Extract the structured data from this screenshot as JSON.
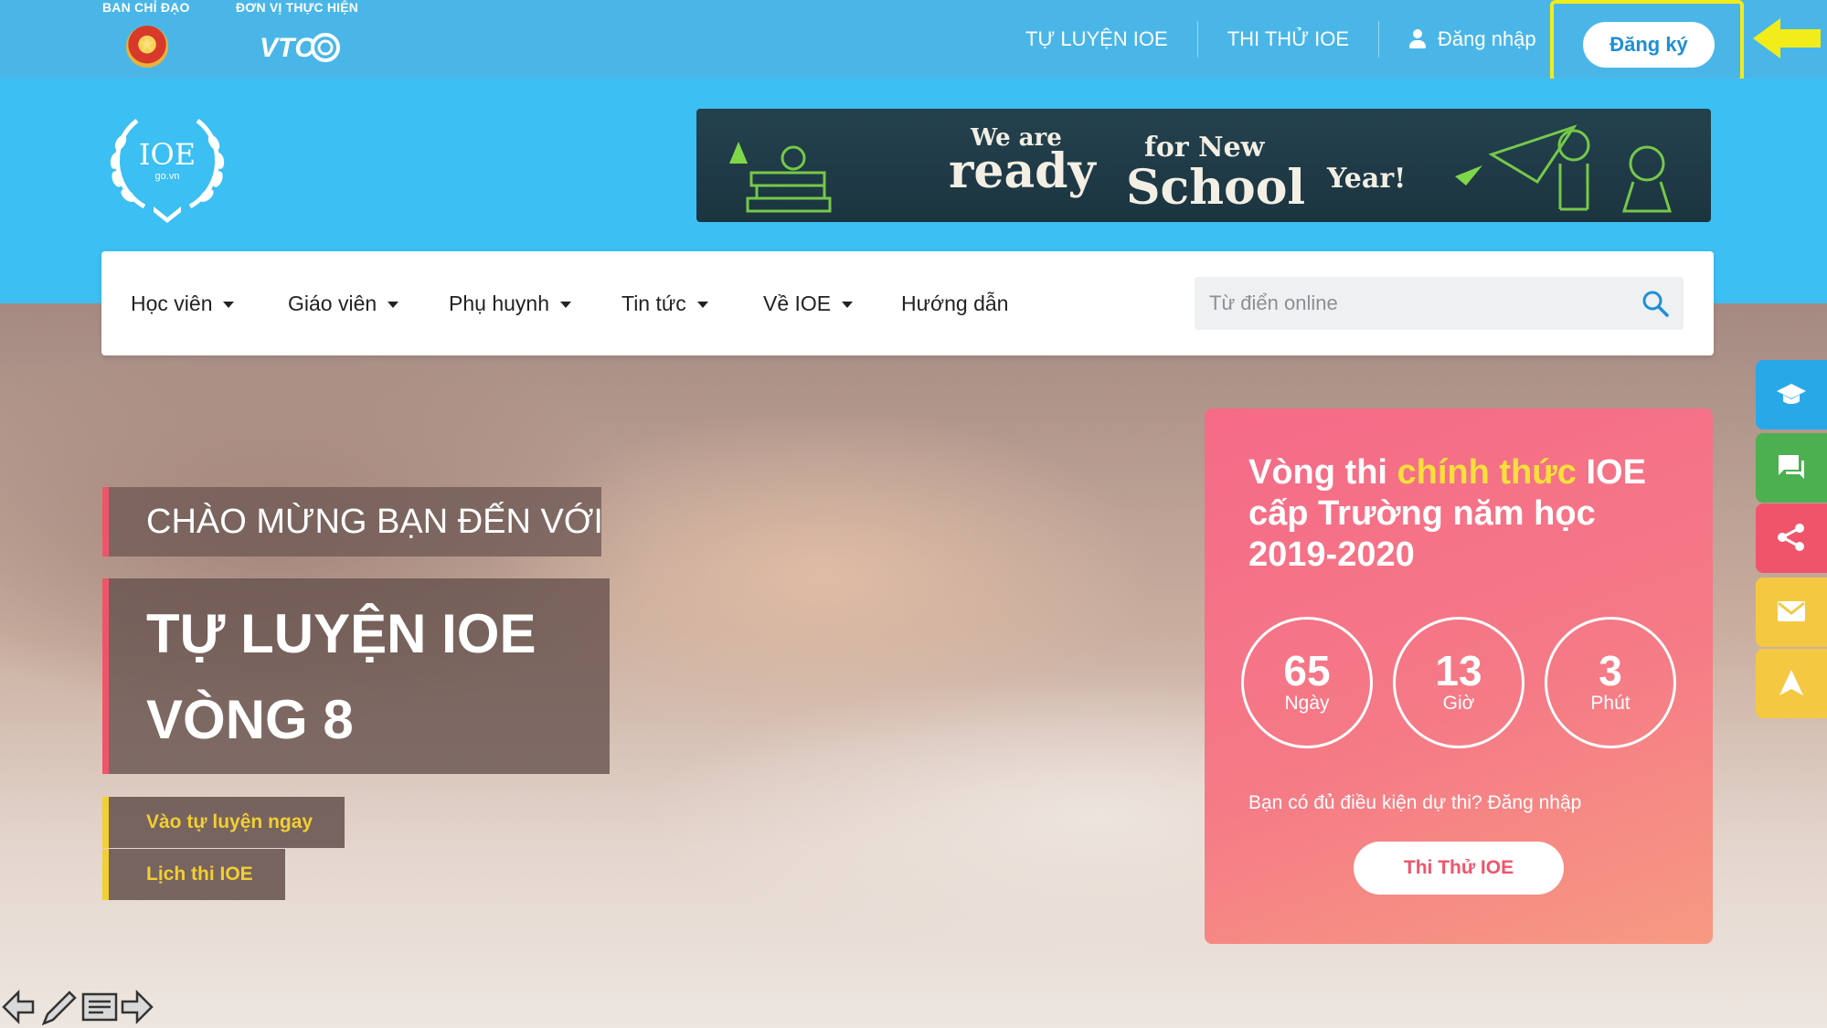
{
  "topbar": {
    "sponsor_label": "BAN CHỈ ĐẠO",
    "organizer_label": "ĐƠN VỊ THỰC HIỆN",
    "organizer_logo_text": "VTC",
    "links": [
      {
        "label": "TỰ LUYỆN IOE"
      },
      {
        "label": "THI THỬ IOE"
      }
    ],
    "login_label": "Đăng nhập",
    "register_label": "Đăng ký"
  },
  "header": {
    "logo_text": "IOE",
    "logo_sub": "go.vn",
    "banner": {
      "line1_a": "We are",
      "line1_b": "ready",
      "line1_c": "for New",
      "line2_a": "School",
      "line2_b": "Year!"
    }
  },
  "nav": {
    "items": [
      {
        "label": "Học viên"
      },
      {
        "label": "Giáo viên"
      },
      {
        "label": "Phụ huynh"
      },
      {
        "label": "Tin tức"
      },
      {
        "label": "Về IOE"
      },
      {
        "label": "Hướng dẫn"
      }
    ],
    "search_placeholder": "Từ điển online"
  },
  "hero": {
    "welcome": "CHÀO MỪNG BẠN ĐẾN VỚI",
    "title_line1": "TỰ LUYỆN IOE",
    "title_line2": "VÒNG 8",
    "cta_practice": "Vào tự luyện ngay",
    "cta_schedule": "Lịch thi IOE"
  },
  "countdown": {
    "title_pre": "Vòng thi ",
    "title_highlight": "chính thức",
    "title_post": " IOE cấp Trường năm học 2019-2020",
    "days": {
      "value": "65",
      "unit": "Ngày"
    },
    "hours": {
      "value": "13",
      "unit": "Giờ"
    },
    "minutes": {
      "value": "3",
      "unit": "Phút"
    },
    "question": "Bạn có đủ điều kiện dự thi?",
    "question_link": "Đăng nhập",
    "button": "Thi Thử IOE"
  },
  "side_buttons": [
    {
      "icon": "graduation-cap-icon",
      "color": "#29a8e8"
    },
    {
      "icon": "chat-icon",
      "color": "#4caf50"
    },
    {
      "icon": "share-icon",
      "color": "#f0546b"
    },
    {
      "icon": "mail-icon",
      "color": "#f5c842"
    },
    {
      "icon": "arrow-up-icon",
      "color": "#f5c842"
    }
  ],
  "colors": {
    "sky": "#3cbff2",
    "topbar": "#4ab6e8",
    "accent_pink": "#f0546b",
    "accent_yellow": "#f2cf32",
    "highlight_box": "#f2ec1a"
  }
}
